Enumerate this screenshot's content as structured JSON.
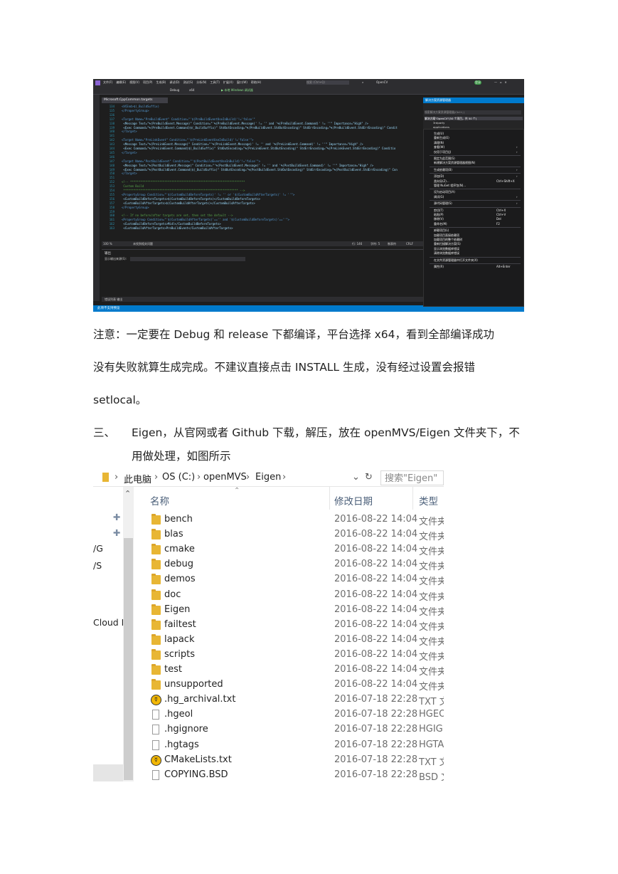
{
  "vs_screenshot": {
    "menu": [
      "文件(F)",
      "编辑(E)",
      "视图(V)",
      "项目(P)",
      "生成(B)",
      "调试(D)",
      "测试(S)",
      "分析(N)",
      "工具(T)",
      "扩展(X)",
      "窗口(W)",
      "帮助(H)"
    ],
    "search_placeholder": "搜索 (Ctrl+Q)",
    "solution_name": "OpenCV",
    "user_badge": "登录",
    "config": "Debug",
    "platform": "x64",
    "debugger": "▶ 本地 Windows 调试器",
    "file_tab": "Microsoft.CppCommon.targets",
    "code_lines": [
      {
        "num": "134",
        "text": "<VCEnd>$(_BuildSuffix)"
      },
      {
        "num": "135",
        "text": "</PropertyGroup>"
      },
      {
        "num": "136",
        "text": ""
      },
      {
        "num": "137",
        "text": "<Target Name=\"PreBuildEvent\" Condition=\"'$(PreBuildEventUseInBuild)'!='false'\""
      },
      {
        "num": "138",
        "text": "  <Message Text=\"%(PreBuildEvent.Message)\" Condition=\"'%(PreBuildEvent.Message)' != '' and '%(PreBuildEvent.Command)' != ''\" Importance=\"High\" />"
      },
      {
        "num": "139",
        "text": "  <Exec Command=\"%(PreBuildEvent.Command)$(_BuildSuffix)\" StdOutEncoding=\"%(PreBuildEvent.StdOutEncoding)\" StdErrEncoding=\"%(PreBuildEvent.StdErrEncoding)\" Condit"
      },
      {
        "num": "140",
        "text": "</Target>"
      },
      {
        "num": "141",
        "text": ""
      },
      {
        "num": "142",
        "text": "<Target Name=\"PreLinkEvent\" Condition=\"'$(PreLinkEventUseInBuild)'!='false'\">"
      },
      {
        "num": "143",
        "text": "  <Message Text=\"%(PreLinkEvent.Message)\" Condition=\"'%(PreLinkEvent.Message)' != '' and '%(PreLinkEvent.Command)' != ''\" Importance=\"High\" />"
      },
      {
        "num": "144",
        "text": "  <Exec Command=\"%(PreLinkEvent.Command)$(_BuildSuffix)\" StdOutEncoding=\"%(PreLinkEvent.StdOutEncoding)\" StdErrEncoding=\"%(PreLinkEvent.StdErrEncoding)\" Conditio"
      },
      {
        "num": "145",
        "text": "</Target>"
      },
      {
        "num": "146",
        "text": ""
      },
      {
        "num": "147",
        "text": "<Target Name=\"PostBuildEvent\" Condition=\"'$(PostBuildEventUseInBuild)'!='false'\">"
      },
      {
        "num": "148",
        "text": "  <Message Text=\"%(PostBuildEvent.Message)\" Condition=\"'%(PostBuildEvent.Message)' != '' and '%(PostBuildEvent.Command)' != ''\" Importance=\"High\" />"
      },
      {
        "num": "149",
        "text": "  <Exec Command=\"%(PostBuildEvent.Command)$(_BuildSuffix)\" StdOutEncoding=\"%(PostBuildEvent.StdOutEncoding)\" StdErrEncoding=\"%(PostBuildEvent.StdErrEncoding)\" Con"
      },
      {
        "num": "150",
        "text": "</Target>"
      },
      {
        "num": "151",
        "text": ""
      },
      {
        "num": "152",
        "text": "<!-- *******************************************************************"
      },
      {
        "num": "153",
        "text": "     Custom Build"
      },
      {
        "num": "154",
        "text": "     ******************************************************************* -->"
      },
      {
        "num": "155",
        "text": "<PropertyGroup Condition=\"'$(CustomBuildBeforeTargets)' != '' or '$(CustomBuildAfterTargets)' != ''\">"
      },
      {
        "num": "156",
        "text": "  <CustomBuildBeforeTargets>$(CustomBuildBeforeTargets)</CustomBuildBeforeTargets>"
      },
      {
        "num": "157",
        "text": "  <CustomBuildAfterTargets>$(CustomBuildAfterTargets)</CustomBuildAfterTargets>"
      },
      {
        "num": "158",
        "text": "</PropertyGroup>"
      },
      {
        "num": "159",
        "text": ""
      },
      {
        "num": "160",
        "text": "<!-- If no before/after targets are set, then set the default -->"
      },
      {
        "num": "161",
        "text": "<PropertyGroup Condition=\"'$(CustomBuildAfterTargets)'=='' and '$(CustomBuildBeforeTargets)'==''\">"
      },
      {
        "num": "162",
        "text": "  <CustomBuildBeforeTargets>Midl</CustomBuildBeforeTargets>"
      },
      {
        "num": "163",
        "text": "  <CustomBuildAfterTargets>PreBuildEvent</CustomBuildAfterTargets>"
      }
    ],
    "zoom": "100 %",
    "no_issues": "未找到相关问题",
    "line_info": "行: 146",
    "col_info": "字符: 5",
    "mode_info": "制表符",
    "eol_info": "CRLF",
    "output_title": "输出",
    "output_source_label": "显示输出来源(S):",
    "bottom_tabs": "错误列表  输出",
    "status_text": "此项不支持预览",
    "solution_panel_title": "解决方案资源管理器",
    "search_solution": "搜索解决方案资源管理器(Ctrl+;)",
    "tree_items": [
      "解决方案\"OpenCV\"(50 个项目，共 50 个)",
      "3rdparty",
      "applications"
    ],
    "context_menu": [
      {
        "label": "生成(U)",
        "shortcut": ""
      },
      {
        "label": "重新生成(E)",
        "shortcut": ""
      },
      {
        "label": "清理(N)",
        "shortcut": ""
      },
      {
        "label": "查看(W)",
        "shortcut": "›"
      },
      {
        "label": "仅用于项目(J)",
        "shortcut": "›"
      },
      {
        "label": "",
        "shortcut": "sep"
      },
      {
        "label": "限定为此范围(S)",
        "shortcut": ""
      },
      {
        "label": "新建解决方案资源管理器视图(N)",
        "shortcut": ""
      },
      {
        "label": "",
        "shortcut": "sep"
      },
      {
        "label": "生成依赖项(B)",
        "shortcut": "›"
      },
      {
        "label": "",
        "shortcut": "sep"
      },
      {
        "label": "添加(D)",
        "shortcut": "›"
      },
      {
        "label": "类向导(Z)...",
        "shortcut": "Ctrl+Shift+X"
      },
      {
        "label": "管理 NuGet 程序包(N)...",
        "shortcut": ""
      },
      {
        "label": "",
        "shortcut": "sep"
      },
      {
        "label": "设为启动项目(A)",
        "shortcut": ""
      },
      {
        "label": "调试(G)",
        "shortcut": "›"
      },
      {
        "label": "",
        "shortcut": "sep"
      },
      {
        "label": "源代码管理(S)",
        "shortcut": "›"
      },
      {
        "label": "",
        "shortcut": "sep"
      },
      {
        "label": "剪切(T)",
        "shortcut": "Ctrl+X"
      },
      {
        "label": "粘贴(P)",
        "shortcut": "Ctrl+V"
      },
      {
        "label": "移除(V)",
        "shortcut": "Del"
      },
      {
        "label": "重命名(M)",
        "shortcut": "F2"
      },
      {
        "label": "",
        "shortcut": "sep"
      },
      {
        "label": "卸载项目(L)",
        "shortcut": ""
      },
      {
        "label": "加载项目直接依赖项",
        "shortcut": ""
      },
      {
        "label": "加载项目的整个依赖树",
        "shortcut": ""
      },
      {
        "label": "重新扫描解决方案(S)",
        "shortcut": ""
      },
      {
        "label": "显示浏览数据库错误",
        "shortcut": ""
      },
      {
        "label": "清除浏览数据库错误",
        "shortcut": ""
      },
      {
        "label": "",
        "shortcut": "sep"
      },
      {
        "label": "在文件资源管理器中打开文件夹(X)",
        "shortcut": ""
      },
      {
        "label": "",
        "shortcut": "sep"
      },
      {
        "label": "属性(R)",
        "shortcut": "Alt+Enter"
      }
    ]
  },
  "paragraphs": {
    "p1_line1": "注意：一定要在 Debug 和 release 下都编译，平台选择 x64，看到全部编译成功",
    "p1_line2": "没有失败就算生成完成。不建议直接点击 INSTALL 生成，没有经过设置会报错",
    "p1_line3": "setlocal。",
    "p2_num": "三、",
    "p2_line1": "Eigen，从官网或者 Github 下载，解压，放在 openMVS/Eigen 文件夹下，不",
    "p2_line2": "用做处理，如图所示"
  },
  "explorer": {
    "breadcrumb": [
      "此电脑",
      "OS (C:)",
      "openMVS",
      "Eigen"
    ],
    "search_placeholder": "搜索\"Eigen\"",
    "nav_items": [
      "/G",
      "/S",
      "Cloud Fi"
    ],
    "col_name": "名称",
    "col_date": "修改日期",
    "col_type": "类型",
    "rows": [
      {
        "name": "bench",
        "date": "2016-08-22 14:04",
        "type": "文件夹",
        "icon": "folder"
      },
      {
        "name": "blas",
        "date": "2016-08-22 14:04",
        "type": "文件夹",
        "icon": "folder"
      },
      {
        "name": "cmake",
        "date": "2016-08-22 14:04",
        "type": "文件夹",
        "icon": "folder"
      },
      {
        "name": "debug",
        "date": "2016-08-22 14:04",
        "type": "文件夹",
        "icon": "folder"
      },
      {
        "name": "demos",
        "date": "2016-08-22 14:04",
        "type": "文件夹",
        "icon": "folder"
      },
      {
        "name": "doc",
        "date": "2016-08-22 14:04",
        "type": "文件夹",
        "icon": "folder"
      },
      {
        "name": "Eigen",
        "date": "2016-08-22 14:04",
        "type": "文件夹",
        "icon": "folder"
      },
      {
        "name": "failtest",
        "date": "2016-08-22 14:04",
        "type": "文件夹",
        "icon": "folder"
      },
      {
        "name": "lapack",
        "date": "2016-08-22 14:04",
        "type": "文件夹",
        "icon": "folder"
      },
      {
        "name": "scripts",
        "date": "2016-08-22 14:04",
        "type": "文件夹",
        "icon": "folder"
      },
      {
        "name": "test",
        "date": "2016-08-22 14:04",
        "type": "文件夹",
        "icon": "folder"
      },
      {
        "name": "unsupported",
        "date": "2016-08-22 14:04",
        "type": "文件夹",
        "icon": "folder"
      },
      {
        "name": ".hg_archival.txt",
        "date": "2016-07-18 22:28",
        "type": "TXT 文",
        "icon": "hg"
      },
      {
        "name": ".hgeol",
        "date": "2016-07-18 22:28",
        "type": "HGEO",
        "icon": "file"
      },
      {
        "name": ".hgignore",
        "date": "2016-07-18 22:28",
        "type": "HGIGI",
        "icon": "file"
      },
      {
        "name": ".hgtags",
        "date": "2016-07-18 22:28",
        "type": "HGTA",
        "icon": "file"
      },
      {
        "name": "CMakeLists.txt",
        "date": "2016-07-18 22:28",
        "type": "TXT 文",
        "icon": "hg"
      },
      {
        "name": "COPYING.BSD",
        "date": "2016-07-18 22:28",
        "type": "BSD 文",
        "icon": "file"
      }
    ]
  }
}
